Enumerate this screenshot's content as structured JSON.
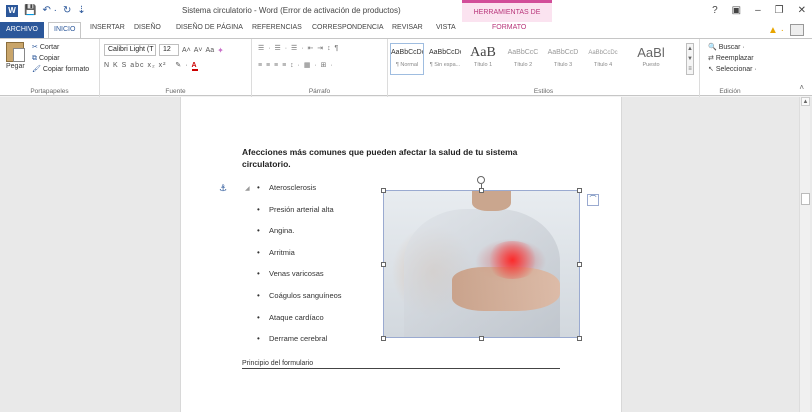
{
  "window": {
    "doc_title": "Sistema circulatorio - Word (Error de activación de productos)",
    "tool_title": "HERRAMIENTAS DE IMAGEN",
    "help": "?",
    "minimize": "–",
    "restore": "❐",
    "close": "✕"
  },
  "tabs": [
    {
      "label": "ARCHIVO"
    },
    {
      "label": "INICIO"
    },
    {
      "label": "INSERTAR"
    },
    {
      "label": "DISEÑO"
    },
    {
      "label": "DISEÑO DE PÁGINA"
    },
    {
      "label": "REFERENCIAS"
    },
    {
      "label": "CORRESPONDENCIA"
    },
    {
      "label": "REVISAR"
    },
    {
      "label": "VISTA"
    },
    {
      "label": "FORMATO"
    }
  ],
  "ribbon": {
    "clipboard": {
      "paste": "Pegar",
      "cut": "Cortar",
      "copy": "Copiar",
      "format_painter": "Copiar formato",
      "label": "Portapapeles"
    },
    "font": {
      "font_name": "Calibri Light (T",
      "font_size": "12",
      "grow": "A˄",
      "shrink": "A˅",
      "case": "Aa",
      "clear": "✦",
      "format_row": "N  K  S  abc  x₂  x²",
      "color_letter": "A",
      "label": "Fuente"
    },
    "paragraph": {
      "row1": "☰ ·  ☰ ·  ☰ ·  ⇤  ⇥  ↕  ¶",
      "row2": "≡  ≡  ≡  ≡   ↕ ·   ▦ ·  ⊞ ·",
      "label": "Párrafo"
    },
    "styles": {
      "items": [
        {
          "sample": "AaBbCcDc",
          "name": "¶ Normal"
        },
        {
          "sample": "AaBbCcDc",
          "name": "¶ Sin espa..."
        },
        {
          "sample": "AaB",
          "name": "Título 1"
        },
        {
          "sample": "AaBbCcC",
          "name": "Título 2"
        },
        {
          "sample": "AaBbCcD",
          "name": "Título 3"
        },
        {
          "sample": "AaBbCcDc",
          "name": "Título 4"
        },
        {
          "sample": "AaBl",
          "name": "Puesto"
        }
      ],
      "label": "Estilos"
    },
    "editing": {
      "find": "Buscar",
      "replace": "Reemplazar",
      "select": "Seleccionar",
      "label": "Edición"
    }
  },
  "document": {
    "heading": "Afecciones más comunes que pueden afectar la salud de tu sistema circulatorio.",
    "bullets": [
      "Aterosclerosis",
      "Presión arterial alta",
      "Angina.",
      "Arritmia",
      "Venas varicosas",
      "Coágulos sanguíneos",
      "Ataque cardíaco",
      "Derrame cerebral"
    ],
    "form_start": "Principio del formulario"
  }
}
